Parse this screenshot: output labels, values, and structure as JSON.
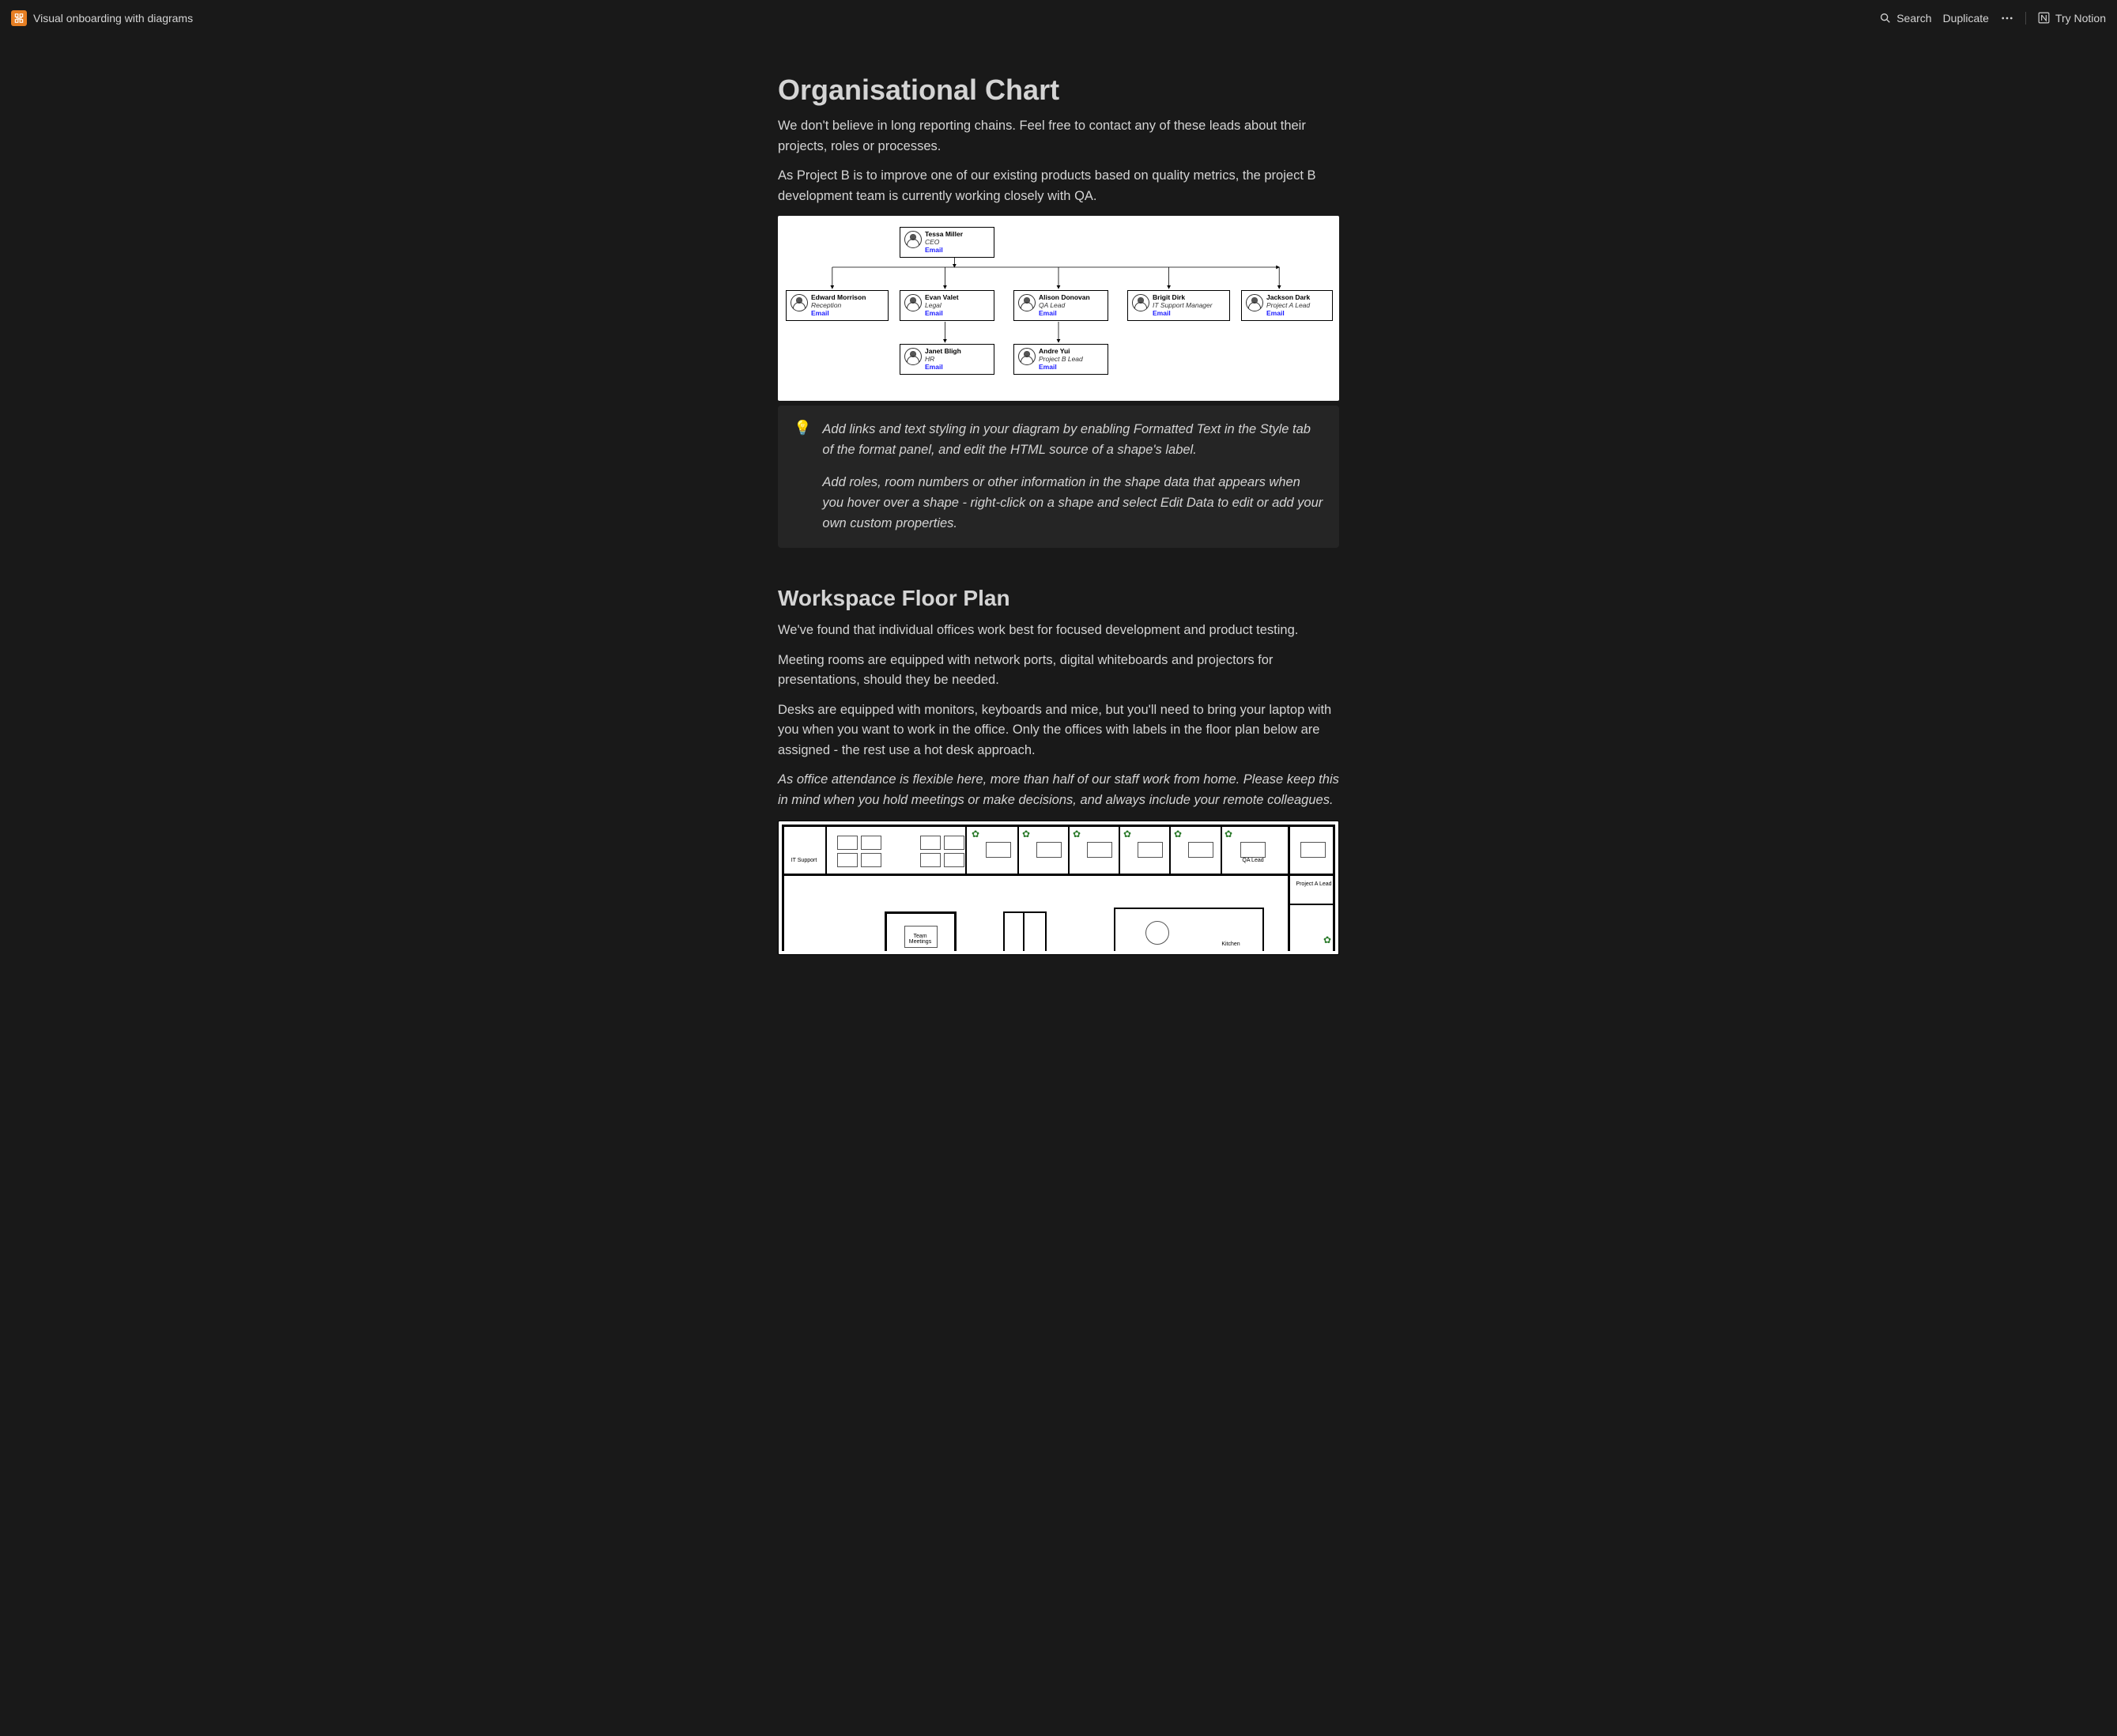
{
  "topbar": {
    "page_title": "Visual onboarding with diagrams",
    "search_label": "Search",
    "duplicate_label": "Duplicate",
    "try_notion_label": "Try Notion"
  },
  "sections": {
    "org": {
      "heading": "Organisational Chart",
      "para1": "We don't believe in long reporting chains. Feel free to contact any of these leads about their projects, roles or processes.",
      "para2": "As Project B is to improve one of our existing products based on quality metrics, the project B development team is currently working closely with QA."
    },
    "callout": {
      "emoji": "💡",
      "p1": "Add links and text styling in your diagram by enabling Formatted Text in the Style tab of the format panel, and edit the HTML source of a shape's label.",
      "p2": "Add roles, room numbers or other information in the shape data that appears when you hover over a shape - right-click on a shape and select Edit Data to edit or add your own custom properties."
    },
    "floor": {
      "heading": "Workspace Floor Plan",
      "para1": "We've found that individual offices work best for focused development and product testing.",
      "para2": "Meeting rooms are equipped with network ports, digital whiteboards and projectors for presentations, should they be needed.",
      "para3": "Desks are equipped with monitors, keyboards and mice, but you'll need to bring your laptop with you when you want to work in the office. Only the offices with labels in the floor plan below are assigned - the rest use a hot desk approach.",
      "para4": "As office attendance is flexible here, more than half of our staff work from home. Please keep this in mind when you hold meetings or make decisions, and always include your remote colleagues."
    }
  },
  "org_chart": {
    "email_label": "Email",
    "ceo": {
      "name": "Tessa Miller",
      "role": "CEO"
    },
    "row2": [
      {
        "name": "Edward Morrison",
        "role": "Reception"
      },
      {
        "name": "Evan Valet",
        "role": "Legal"
      },
      {
        "name": "Alison Donovan",
        "role": "QA Lead"
      },
      {
        "name": "Brigit Dirk",
        "role": "IT Support Manager"
      },
      {
        "name": "Jackson Dark",
        "role": "Project A Lead"
      }
    ],
    "row3": [
      {
        "name": "Janet Bligh",
        "role": "HR"
      },
      {
        "name": "Andre Yui",
        "role": "Project B Lead"
      }
    ]
  },
  "floor_plan": {
    "labels": {
      "it_support": "IT Support",
      "qa_lead": "QA Lead",
      "project_a": "Project A Lead",
      "team_meetings": "Team\nMeetings",
      "kitchen": "Kitchen"
    }
  }
}
